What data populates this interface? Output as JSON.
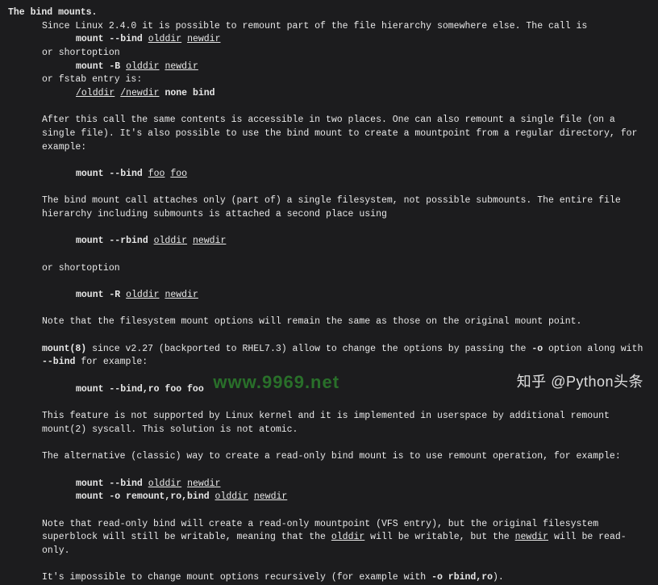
{
  "header": {
    "title": "The bind mounts."
  },
  "lines": {
    "l1": "Since Linux 2.4.0 it is possible to remount part of the file hierarchy somewhere else. The call is",
    "l2a": "mount --bind",
    "l2b": "olddir",
    "l2c": "newdir",
    "l3": "or shortoption",
    "l4a": "mount -B",
    "l4b": "olddir",
    "l4c": "newdir",
    "l5": "or fstab entry is:",
    "l6a": "/olddir",
    "l6b": "/newdir",
    "l6c": "none bind",
    "l7": "After  this  call the same contents is accessible in two places.  One can also remount a single file (on a single file). It's also possible to use the bind mount to create a mountpoint from a regular directory, for example:",
    "l8a": "mount --bind",
    "l8b": "foo",
    "l8c": "foo",
    "l9": "The bind mount call attaches only (part of) a single filesystem, not possible submounts. The entire file hierarchy  including submounts is attached a second place using",
    "l10a": "mount --rbind",
    "l10b": "olddir",
    "l10c": "newdir",
    "l11": "or shortoption",
    "l12a": "mount -R",
    "l12b": "olddir",
    "l12c": "newdir",
    "l13": "Note that the filesystem mount options will remain the same as those on the original mount point.",
    "l14a": "mount(8)",
    "l14b": " since v2.27 (backported to RHEL7.3) allow to change the options by passing the ",
    "l14c": "-o",
    "l14d": " option along with ",
    "l14e": "--bind",
    "l14f": " for example:",
    "l15": "mount --bind,ro foo foo",
    "l16": "This feature is not supported by Linux kernel and it is implemented in userspace by additional remount mount(2) syscall. This solution is not atomic.",
    "l17": "The alternative (classic) way to create a read-only bind mount is to use remount operation, for example:",
    "l18a": "mount --bind",
    "l18b": "olddir",
    "l18c": "newdir",
    "l19a": "mount -o remount,ro,bind",
    "l19b": "olddir",
    "l19c": "newdir",
    "l20a": "Note that read-only bind will create a read-only mountpoint (VFS entry), but the original filesystem superblock will still be writable, meaning that the ",
    "l20b": "olddir",
    "l20c": " will be writable, but the ",
    "l20d": "newdir",
    "l20e": " will be read-only.",
    "l21a": "It's impossible to change mount options recursively (for example with  ",
    "l21b": "-o rbind,ro",
    "l21c": ")."
  },
  "watermarks": {
    "center": "www.9969.net",
    "right": "知乎 @Python头条"
  }
}
